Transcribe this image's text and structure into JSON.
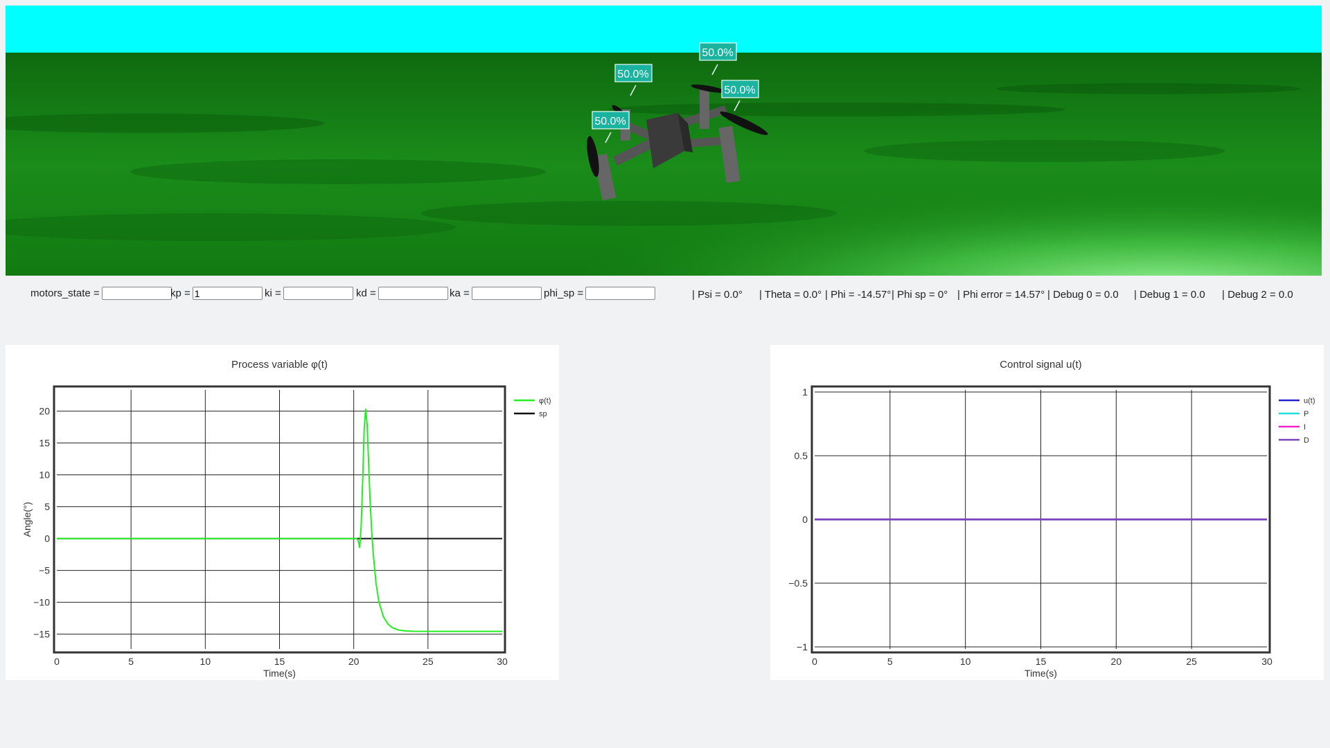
{
  "scene": {
    "sky_color": "#00ffff",
    "ground_color": "#1a8a1a",
    "motor_labels": [
      "50.0%",
      "50.0%",
      "50.0%",
      "50.0%"
    ]
  },
  "controls": {
    "inputs": [
      {
        "label": "motors_state =",
        "value": ""
      },
      {
        "label": "kp =",
        "value": "1"
      },
      {
        "label": "ki =",
        "value": ""
      },
      {
        "label": "kd =",
        "value": ""
      },
      {
        "label": "ka =",
        "value": ""
      },
      {
        "label": "phi_sp =",
        "value": ""
      }
    ],
    "status": [
      "| Psi = 0.0°",
      "| Theta = 0.0°",
      "| Phi = -14.57°",
      "| Phi sp = 0°",
      "| Phi error = 14.57°",
      "| Debug 0 = 0.0",
      "| Debug 1 = 0.0",
      "| Debug 2 = 0.0"
    ]
  },
  "chart_data": [
    {
      "type": "line",
      "title": "Process variable φ(t)",
      "xlabel": "Time(s)",
      "ylabel": "Angle(°)",
      "xlim": [
        0,
        30
      ],
      "ylim": [
        -17,
        23
      ],
      "xticks": [
        0,
        5,
        10,
        15,
        20,
        25,
        30
      ],
      "yticks": [
        20,
        15,
        10,
        5,
        0,
        -5,
        -10,
        -15
      ],
      "ytick_labels": [
        "20",
        "15",
        "10",
        "5",
        "0",
        "−5",
        "−10",
        "−15"
      ],
      "grid": true,
      "legend": "top-right",
      "series": [
        {
          "name": "φ(t)",
          "color": "#22ee22",
          "x": [
            0,
            20.2,
            20.3,
            20.4,
            20.5,
            20.6,
            20.7,
            20.8,
            20.9,
            21.0,
            21.1,
            21.2,
            21.3,
            21.5,
            21.7,
            22.0,
            22.3,
            22.6,
            23.0,
            23.5,
            24.0,
            25.0,
            26.0,
            28.0,
            30.0
          ],
          "y": [
            0,
            0,
            -0.3,
            -1.4,
            2,
            9,
            17,
            20.3,
            18,
            12,
            6,
            1.5,
            -2,
            -7,
            -10,
            -12.3,
            -13.4,
            -14,
            -14.35,
            -14.5,
            -14.55,
            -14.57,
            -14.57,
            -14.57,
            -14.57
          ]
        },
        {
          "name": "sp",
          "color": "#111111",
          "x": [
            0,
            30
          ],
          "y": [
            0,
            0
          ]
        }
      ]
    },
    {
      "type": "line",
      "title": "Control signal u(t)",
      "xlabel": "Time(s)",
      "ylabel": "",
      "xlim": [
        0,
        30
      ],
      "ylim": [
        -1,
        1
      ],
      "xticks": [
        0,
        5,
        10,
        15,
        20,
        25,
        30
      ],
      "yticks": [
        1,
        0.5,
        0,
        -0.5,
        -1
      ],
      "ytick_labels": [
        "1",
        "0.5",
        "0",
        "−0.5",
        "−1"
      ],
      "grid": true,
      "legend": "top-right",
      "series": [
        {
          "name": "u(t)",
          "color": "#2222cc",
          "x": [
            0,
            30
          ],
          "y": [
            0,
            0
          ]
        },
        {
          "name": "P",
          "color": "#22dddd",
          "x": [
            0,
            30
          ],
          "y": [
            0,
            0
          ]
        },
        {
          "name": "I",
          "color": "#ee22cc",
          "x": [
            0,
            30
          ],
          "y": [
            0,
            0
          ]
        },
        {
          "name": "D",
          "color": "#7744bb",
          "x": [
            0,
            30
          ],
          "y": [
            0,
            0
          ]
        }
      ]
    }
  ]
}
